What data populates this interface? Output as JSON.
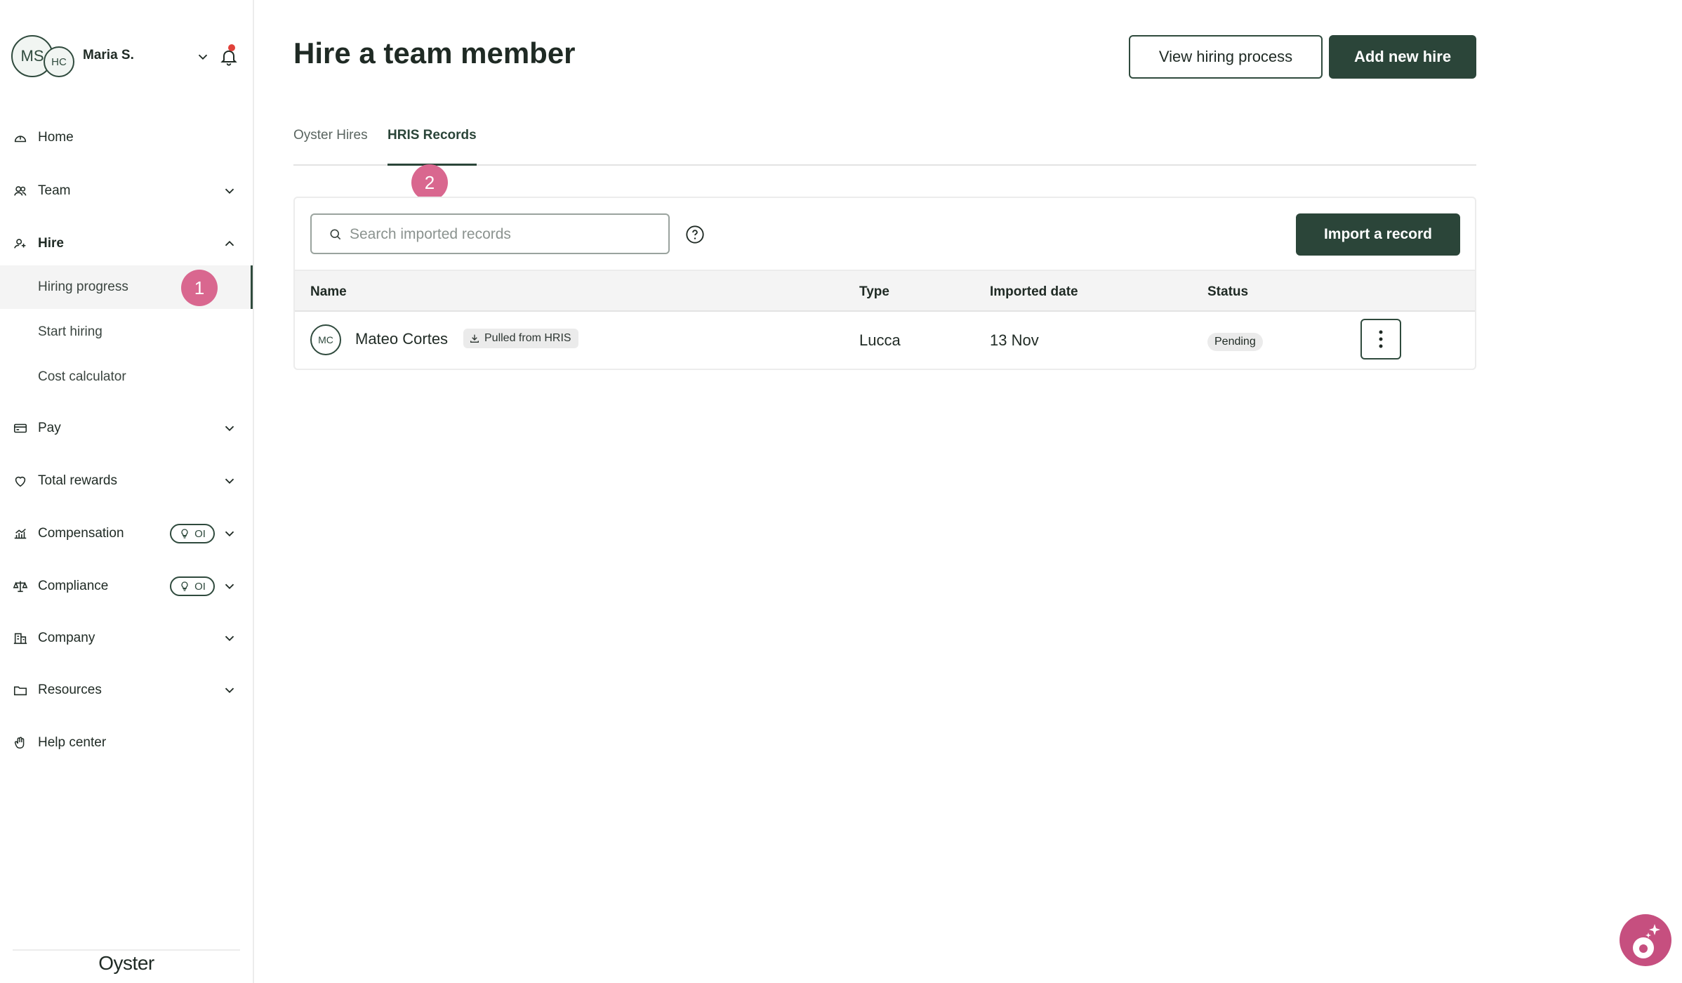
{
  "user": {
    "initials_primary": "MS",
    "initials_secondary": "HC",
    "name": "Maria S."
  },
  "sidebar": {
    "items": [
      {
        "label": "Home",
        "icon": "home-icon"
      },
      {
        "label": "Team",
        "icon": "team-icon"
      },
      {
        "label": "Hire",
        "icon": "hire-icon"
      },
      {
        "label": "Hiring progress"
      },
      {
        "label": "Start hiring"
      },
      {
        "label": "Cost calculator"
      },
      {
        "label": "Pay",
        "icon": "card-icon"
      },
      {
        "label": "Total rewards",
        "icon": "heart-icon"
      },
      {
        "label": "Compensation",
        "icon": "chart-icon",
        "badge": "OI"
      },
      {
        "label": "Compliance",
        "icon": "scale-icon",
        "badge": "OI"
      },
      {
        "label": "Company",
        "icon": "building-icon"
      },
      {
        "label": "Resources",
        "icon": "folder-icon"
      },
      {
        "label": "Help center",
        "icon": "help-hand-icon"
      }
    ],
    "logo": "Oyster"
  },
  "annotations": {
    "step1": "1",
    "step2": "2"
  },
  "header": {
    "title": "Hire a team member",
    "view_process_label": "View hiring process",
    "add_hire_label": "Add new hire"
  },
  "tabs": [
    {
      "label": "Oyster Hires",
      "active": false
    },
    {
      "label": "HRIS Records",
      "active": true
    }
  ],
  "search": {
    "placeholder": "Search imported records",
    "value": ""
  },
  "import_label": "Import a record",
  "table": {
    "columns": [
      "Name",
      "Type",
      "Imported date",
      "Status"
    ],
    "rows": [
      {
        "initials": "MC",
        "name": "Mateo Cortes",
        "source_chip": "Pulled from HRIS",
        "type": "Lucca",
        "imported_date": "13 Nov",
        "status": "Pending"
      }
    ]
  },
  "colors": {
    "primary": "#2b4539",
    "annotation": "#d9678f",
    "fab": "#c64f7f",
    "notification_dot": "#e0413a"
  }
}
